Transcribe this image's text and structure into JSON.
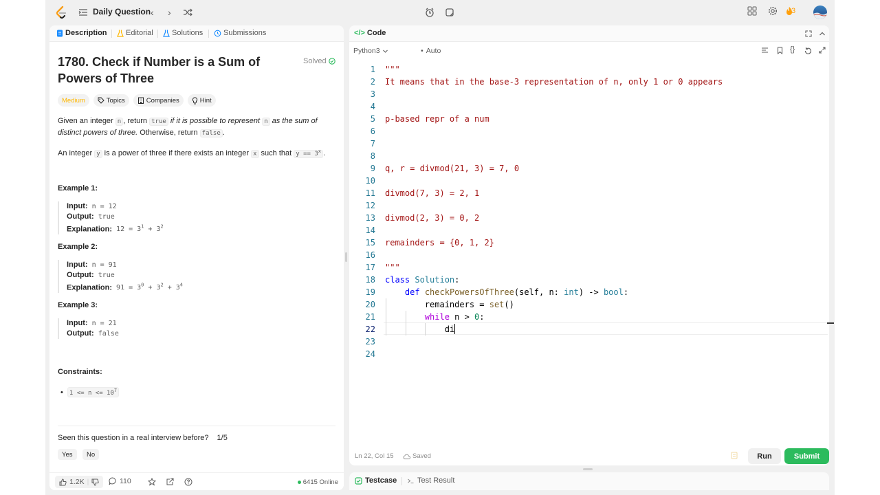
{
  "topbar": {
    "title": "Daily Question",
    "streak": "3"
  },
  "left_tabs": {
    "description": "Description",
    "editorial": "Editorial",
    "solutions": "Solutions",
    "submissions": "Submissions"
  },
  "problem": {
    "title": "1780. Check if Number is a Sum of Powers of Three",
    "status": "Solved",
    "difficulty": "Medium",
    "chips": {
      "topics": "Topics",
      "companies": "Companies",
      "hint": "Hint"
    },
    "p1": {
      "t1": "Given an integer ",
      "c1": "n",
      "t2": ", return ",
      "c2": "true",
      "i1": " if it is possible to represent ",
      "c3": "n",
      "i2": " as the sum of distinct powers of three.",
      "t3": " Otherwise, return ",
      "c4": "false",
      "t4": "."
    },
    "p2": {
      "t1": "An integer ",
      "c1": "y",
      "t2": " is a power of three if there exists an integer ",
      "c2": "x",
      "t3": " such that ",
      "c3": "y == 3",
      "c3sup": "x",
      "t4": "."
    },
    "examples": [
      {
        "heading": "Example 1:",
        "input_label": "Input:",
        "input": "n = 12",
        "output_label": "Output:",
        "output": "true",
        "expl_label": "Explanation:",
        "expl": "12 = 3",
        "s1": "1",
        "e2": " + 3",
        "s2": "2"
      },
      {
        "heading": "Example 2:",
        "input_label": "Input:",
        "input": "n = 91",
        "output_label": "Output:",
        "output": "true",
        "expl_label": "Explanation:",
        "expl": "91 = 3",
        "s1": "0",
        "e2": " + 3",
        "s2": "2",
        "e3": " + 3",
        "s3": "4"
      },
      {
        "heading": "Example 3:",
        "input_label": "Input:",
        "input": "n = 21",
        "output_label": "Output:",
        "output": "false"
      }
    ],
    "constraints_heading": "Constraints:",
    "constraint": "1 <= n <= 10",
    "constraint_sup": "7",
    "seen_q": "Seen this question in a real interview before?",
    "seen_count": "1/5",
    "yes": "Yes",
    "no": "No",
    "likes": "1.2K",
    "comments": "110",
    "online": "6415 Online"
  },
  "code_panel": {
    "tab": "Code",
    "language": "Python3",
    "mode": "Auto",
    "cursor_status": "Ln 22, Col 15",
    "saved": "Saved",
    "run": "Run",
    "submit": "Submit"
  },
  "code_lines": [
    "\"\"\"",
    "It means that in the base-3 representation of n, only 1 or 0 appears",
    "",
    "",
    "p-based repr of a num",
    "",
    "",
    "",
    "q, r = divmod(21, 3) = 7, 0",
    "",
    "divmod(7, 3) = 2, 1",
    "",
    "divmod(2, 3) = 0, 2",
    "",
    "remainders = {0, 1, 2}",
    "",
    "\"\"\"",
    "class Solution:",
    "    def checkPowersOfThree(self, n: int) -> bool:",
    "        remainders = set()",
    "        while n > 0:",
    "            di",
    "",
    ""
  ],
  "bottom_tabs": {
    "testcase": "Testcase",
    "test_result": "Test Result"
  },
  "colors": {
    "accent_green": "#2cbb5d",
    "medium": "#ffb800",
    "string": "#a31515",
    "keyword": "#0000ff",
    "line_number": "#237893"
  }
}
